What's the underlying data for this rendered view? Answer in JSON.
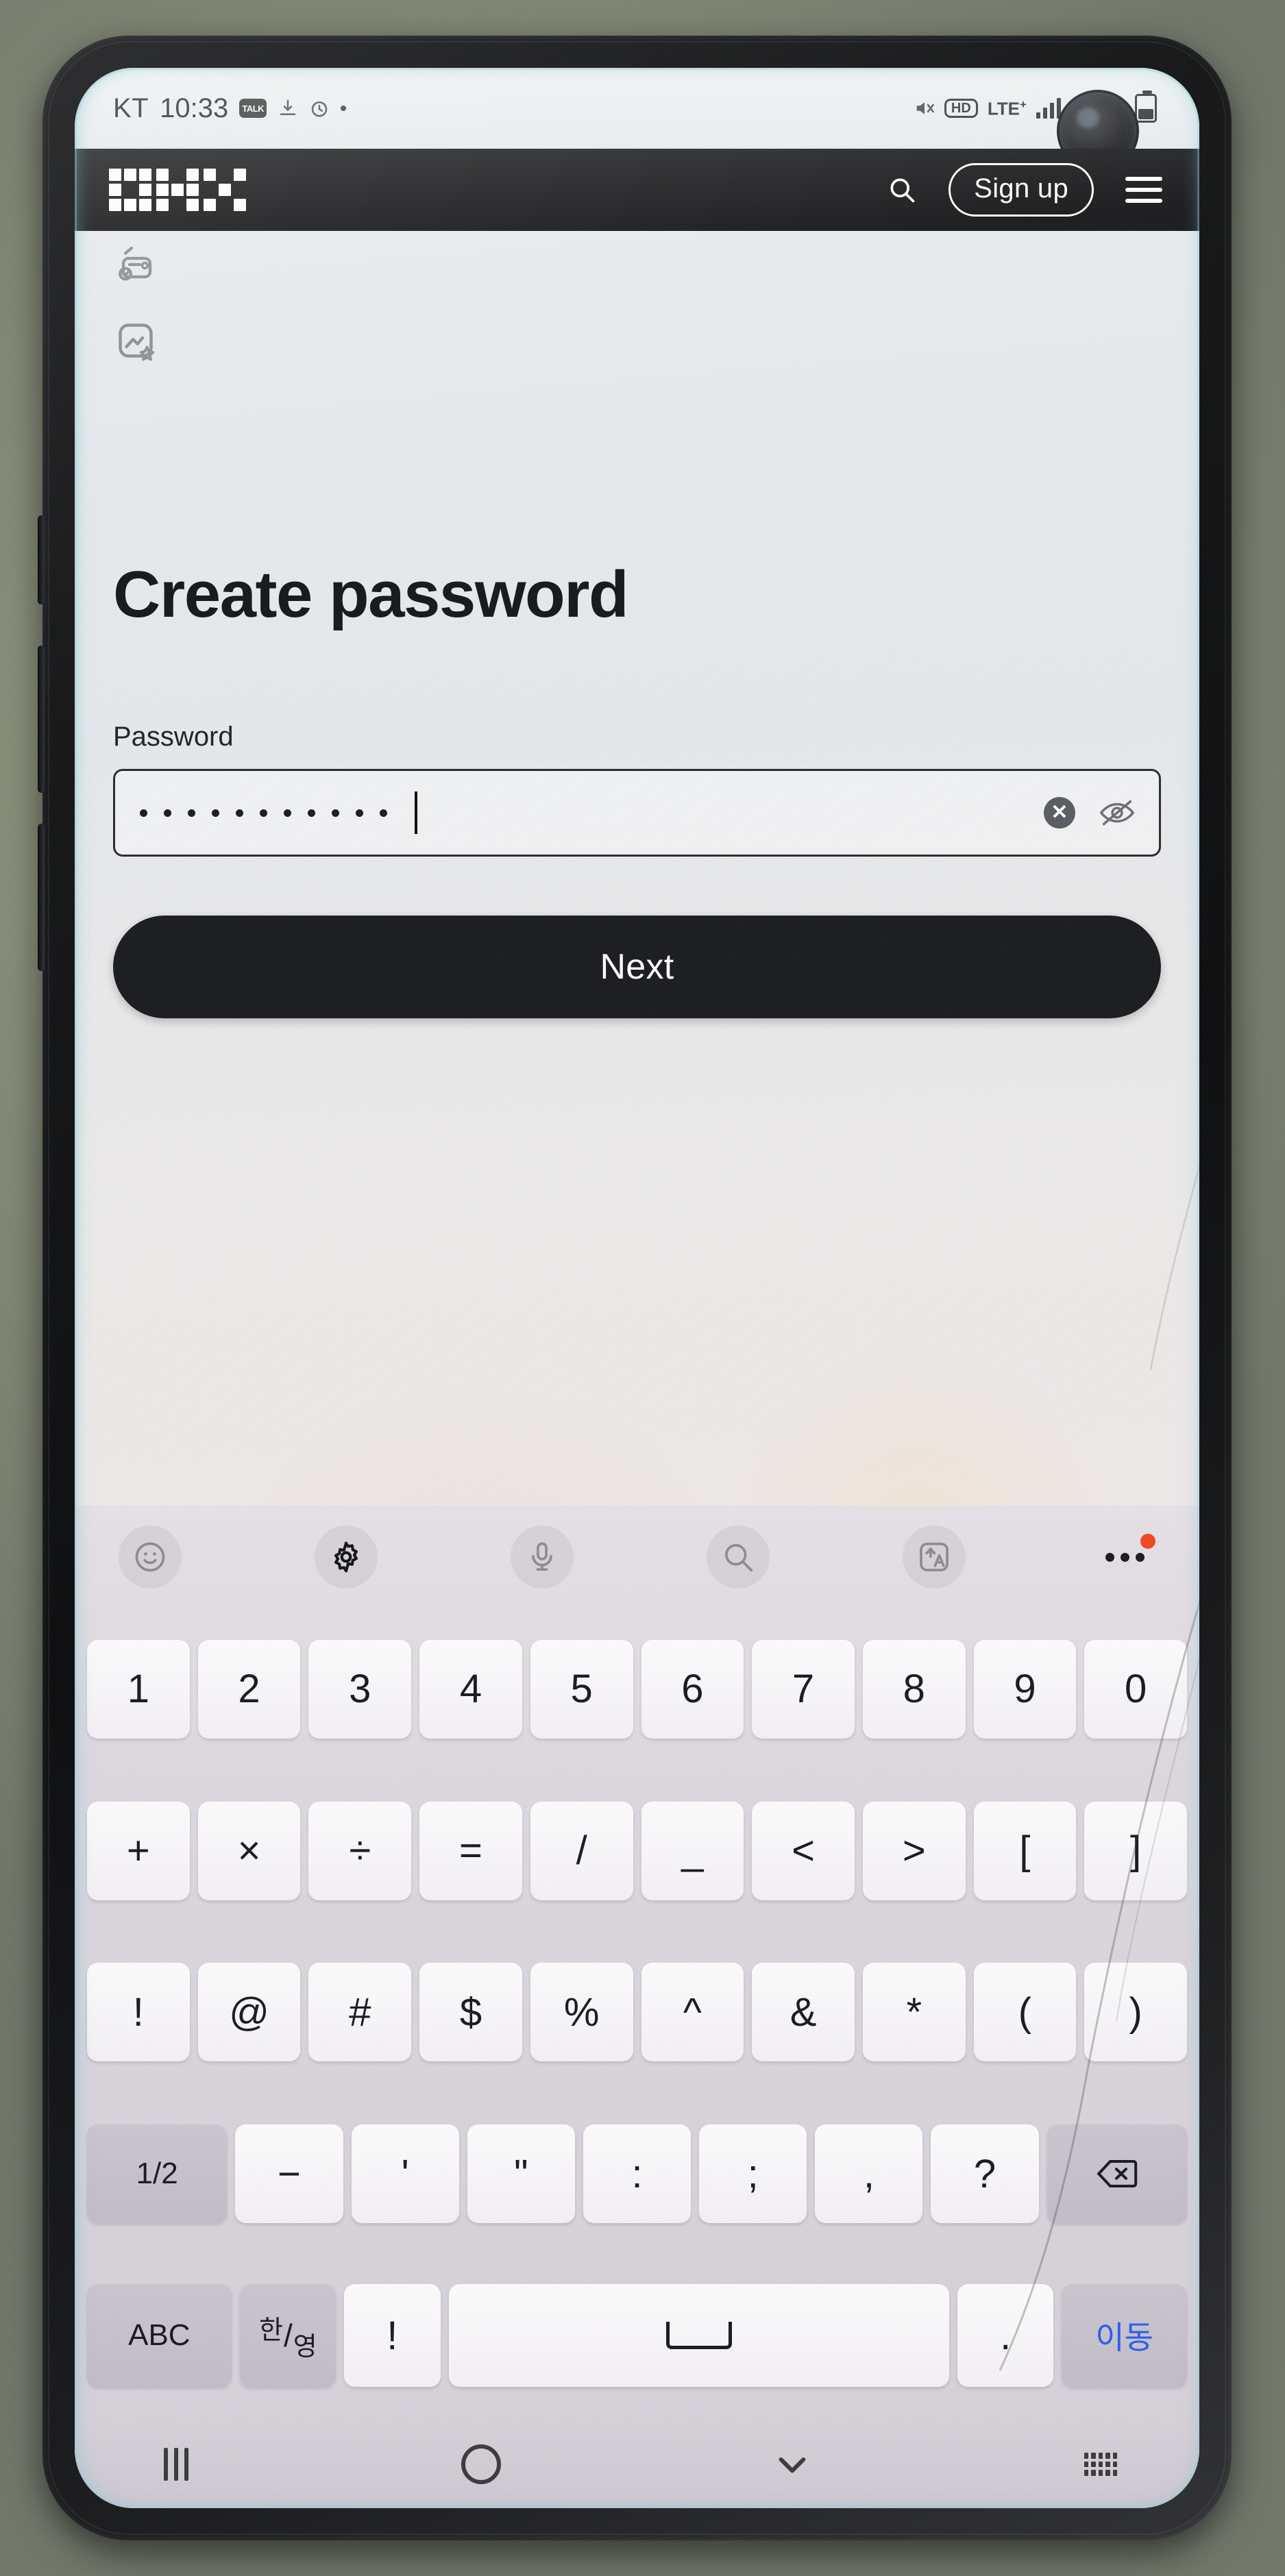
{
  "status_bar": {
    "carrier": "KT",
    "time": "10:33",
    "kakao_label": "TALK",
    "hd_label": "HD",
    "network": "LTE",
    "network_sup": "+",
    "battery_percent": "47%"
  },
  "okx_header": {
    "logo_alt": "OKX",
    "search_icon": "search-icon",
    "signup_label": "Sign up",
    "menu_icon": "hamburger-menu-icon"
  },
  "page": {
    "broken_image_1": "broken-image-icon",
    "broken_image_2": "broken-image-icon",
    "title": "Create password",
    "field_label": "Password",
    "password_value": "•••••••••••",
    "password_dot_count": 11,
    "clear_icon": "clear-circle-icon",
    "reveal_icon": "eye-off-icon",
    "next_label": "Next"
  },
  "keyboard": {
    "toolbar": [
      {
        "name": "emoji-icon",
        "label": "emoji"
      },
      {
        "name": "gear-icon",
        "label": "settings"
      },
      {
        "name": "microphone-icon",
        "label": "voice input"
      },
      {
        "name": "search-icon",
        "label": "search"
      },
      {
        "name": "translate-icon",
        "label": "translate"
      },
      {
        "name": "more-options-icon",
        "label": "more"
      }
    ],
    "rows": [
      [
        "1",
        "2",
        "3",
        "4",
        "5",
        "6",
        "7",
        "8",
        "9",
        "0"
      ],
      [
        "+",
        "×",
        "÷",
        "=",
        "/",
        "_",
        "<",
        ">",
        "[",
        "]"
      ],
      [
        "!",
        "@",
        "#",
        "$",
        "%",
        "^",
        "&",
        "*",
        "(",
        ")"
      ],
      [
        "1/2",
        "−",
        "'",
        "\"",
        ":",
        ";",
        ",",
        "?",
        "⌫"
      ],
      [
        "ABC",
        "한/영",
        "!",
        "␣",
        ".",
        "이동"
      ]
    ],
    "page_toggle": "1/2",
    "backspace": "backspace-icon",
    "abc_label": "ABC",
    "lang_label_top": "한",
    "lang_label_bottom": "영",
    "exclaim_label": "!",
    "space_label": "space",
    "period_label": ".",
    "go_label": "이동"
  },
  "nav_bar": {
    "recents": "recent-apps-icon",
    "home": "home-icon",
    "back": "hide-keyboard-icon",
    "keyboard_switch": "keyboard-switcher-icon"
  },
  "colors": {
    "okx_header_bg": "#0f1012",
    "next_button_bg": "#1b1d21",
    "go_key_text": "#2b5cf0",
    "badge_red": "#f04a23",
    "keyboard_bg": "#d8d3da"
  }
}
